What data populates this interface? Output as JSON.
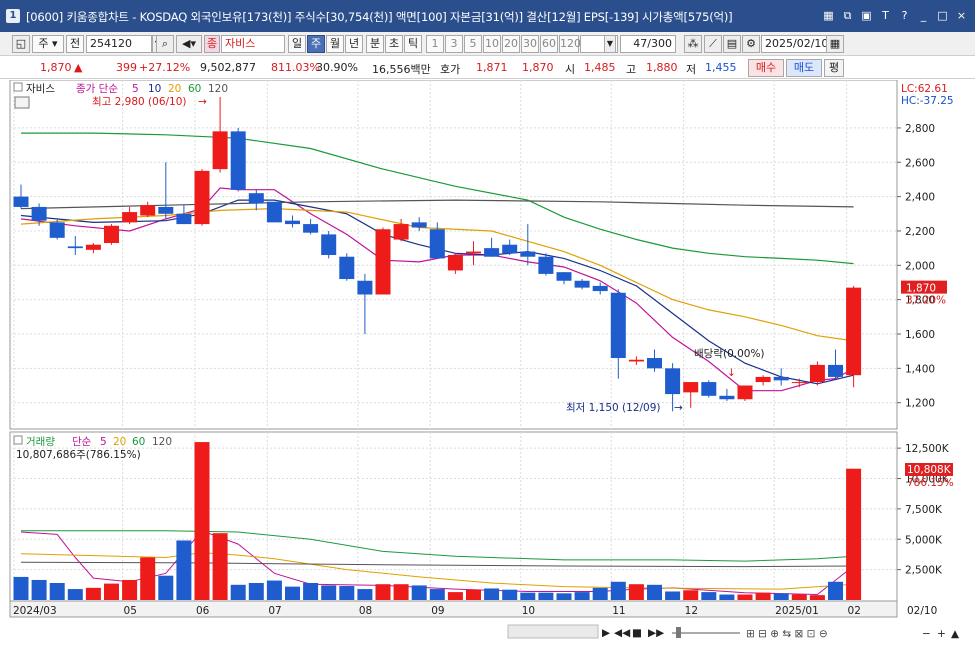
{
  "window": {
    "number": "1",
    "title": "[0600] 키움종합차트 - KOSDAQ 외국인보유[173(천)] 주식수[30,754(천)] 액면[100] 자본금[31(억)] 결산[12월] EPS[-139] 시가총액[575(억)]",
    "icons": [
      "chart-icon",
      "window-copy-icon",
      "save-icon",
      "text-tool-icon",
      "help-icon"
    ],
    "buttons": {
      "minimize": "_",
      "maximize": "□",
      "close": "×"
    }
  },
  "toolbar": {
    "period_type": "주",
    "all_label": "전",
    "code": "254120",
    "search_icon": "magnifier-icon",
    "sound_icon": "speaker-icon",
    "stock_prefix": "종",
    "stock_name": "자비스",
    "periods": [
      "일",
      "주",
      "월",
      "년",
      "분",
      "초",
      "틱"
    ],
    "active_period": "주",
    "intervals": [
      "1",
      "3",
      "5",
      "10",
      "20",
      "30",
      "60",
      "120"
    ],
    "count": "47/300",
    "date": "2025/02/10",
    "calendar_icon": "calendar-icon"
  },
  "quote": {
    "price": "1,870",
    "change_arrow": "▲",
    "change": "399",
    "change_pct": "+27.12%",
    "volume": "9,502,877",
    "volume_ratio": "811.03%",
    "turnover": "30.90%",
    "amount": "16,556백만",
    "hoga_label": "호가",
    "ask": "1,871",
    "bid": "1,870",
    "open_label": "시",
    "open": "1,485",
    "high_label": "고",
    "high": "1,880",
    "low_label": "저",
    "low": "1,455",
    "buy_label": "매수",
    "sell_label": "매도",
    "avg_label": "평"
  },
  "price_legend": {
    "name": "자비스",
    "type": "종가 단순",
    "periods": [
      "5",
      "10",
      "20",
      "60",
      "120"
    ],
    "period_colors": [
      "#c0139b",
      "#1a2f8a",
      "#e0a000",
      "#1a9a3a",
      "#555555"
    ],
    "lc": "LC:62.61",
    "hc": "HC:-37.25",
    "current_price": "1,870",
    "current_pct": "37.20%"
  },
  "annotations": {
    "high_label": "최고 2,980 (06/10)",
    "low_label": "최저 1,150 (12/09)",
    "dividend_label": "배당락(0.00%)"
  },
  "volume_legend": {
    "name": "거래량",
    "type": "단순",
    "periods": [
      "5",
      "20",
      "60",
      "120"
    ],
    "period_colors": [
      "#c0139b",
      "#e0a000",
      "#1a9a3a",
      "#555555"
    ],
    "info": "10,807,686주(786.15%)",
    "current_value": "10,808K",
    "current_pct": "786.15%"
  },
  "x_axis": {
    "labels": [
      "2024/03",
      "05",
      "06",
      "07",
      "08",
      "09",
      "10",
      "11",
      "12",
      "2025/01",
      "02",
      "02/10"
    ]
  },
  "chart_data": {
    "type": "candlestick",
    "candles": [
      {
        "o": 2400,
        "h": 2470,
        "l": 2330,
        "c": 2340
      },
      {
        "o": 2340,
        "h": 2360,
        "l": 2230,
        "c": 2260
      },
      {
        "o": 2250,
        "h": 2270,
        "l": 2150,
        "c": 2160
      },
      {
        "o": 2110,
        "h": 2170,
        "l": 2060,
        "c": 2100
      },
      {
        "o": 2090,
        "h": 2130,
        "l": 2070,
        "c": 2120
      },
      {
        "o": 2130,
        "h": 2240,
        "l": 2120,
        "c": 2230
      },
      {
        "o": 2250,
        "h": 2340,
        "l": 2240,
        "c": 2310
      },
      {
        "o": 2290,
        "h": 2370,
        "l": 2280,
        "c": 2350
      },
      {
        "o": 2340,
        "h": 2600,
        "l": 2270,
        "c": 2300
      },
      {
        "o": 2300,
        "h": 2350,
        "l": 2240,
        "c": 2240
      },
      {
        "o": 2240,
        "h": 2560,
        "l": 2230,
        "c": 2550
      },
      {
        "o": 2560,
        "h": 2980,
        "l": 2540,
        "c": 2780
      },
      {
        "o": 2780,
        "h": 2800,
        "l": 2430,
        "c": 2440
      },
      {
        "o": 2420,
        "h": 2440,
        "l": 2320,
        "c": 2360
      },
      {
        "o": 2370,
        "h": 2370,
        "l": 2250,
        "c": 2250
      },
      {
        "o": 2260,
        "h": 2290,
        "l": 2220,
        "c": 2240
      },
      {
        "o": 2240,
        "h": 2270,
        "l": 2180,
        "c": 2190
      },
      {
        "o": 2180,
        "h": 2200,
        "l": 2040,
        "c": 2060
      },
      {
        "o": 2050,
        "h": 2070,
        "l": 1910,
        "c": 1920
      },
      {
        "o": 1910,
        "h": 1950,
        "l": 1600,
        "c": 1830
      },
      {
        "o": 1830,
        "h": 2220,
        "l": 1830,
        "c": 2210
      },
      {
        "o": 2150,
        "h": 2270,
        "l": 2140,
        "c": 2240
      },
      {
        "o": 2250,
        "h": 2280,
        "l": 2200,
        "c": 2220
      },
      {
        "o": 2210,
        "h": 2250,
        "l": 2040,
        "c": 2040
      },
      {
        "o": 1970,
        "h": 2070,
        "l": 1950,
        "c": 2060
      },
      {
        "o": 2070,
        "h": 2140,
        "l": 2000,
        "c": 2080
      },
      {
        "o": 2100,
        "h": 2160,
        "l": 2050,
        "c": 2050
      },
      {
        "o": 2120,
        "h": 2150,
        "l": 2060,
        "c": 2070
      },
      {
        "o": 2080,
        "h": 2240,
        "l": 2000,
        "c": 2050
      },
      {
        "o": 2050,
        "h": 2070,
        "l": 1940,
        "c": 1950
      },
      {
        "o": 1960,
        "h": 1960,
        "l": 1890,
        "c": 1910
      },
      {
        "o": 1910,
        "h": 1920,
        "l": 1860,
        "c": 1870
      },
      {
        "o": 1880,
        "h": 1900,
        "l": 1830,
        "c": 1850
      },
      {
        "o": 1840,
        "h": 1860,
        "l": 1340,
        "c": 1460
      },
      {
        "o": 1440,
        "h": 1470,
        "l": 1420,
        "c": 1450
      },
      {
        "o": 1460,
        "h": 1510,
        "l": 1380,
        "c": 1400
      },
      {
        "o": 1400,
        "h": 1430,
        "l": 1150,
        "c": 1250
      },
      {
        "o": 1260,
        "h": 1320,
        "l": 1170,
        "c": 1320
      },
      {
        "o": 1320,
        "h": 1330,
        "l": 1230,
        "c": 1240
      },
      {
        "o": 1240,
        "h": 1280,
        "l": 1210,
        "c": 1220
      },
      {
        "o": 1220,
        "h": 1300,
        "l": 1210,
        "c": 1300
      },
      {
        "o": 1320,
        "h": 1360,
        "l": 1300,
        "c": 1350
      },
      {
        "o": 1350,
        "h": 1400,
        "l": 1300,
        "c": 1330
      },
      {
        "o": 1320,
        "h": 1340,
        "l": 1290,
        "c": 1320
      },
      {
        "o": 1320,
        "h": 1440,
        "l": 1300,
        "c": 1420
      },
      {
        "o": 1420,
        "h": 1510,
        "l": 1340,
        "c": 1350
      },
      {
        "o": 1360,
        "h": 1880,
        "l": 1290,
        "c": 1870
      }
    ],
    "volumes": [
      1900,
      1650,
      1400,
      900,
      1000,
      1350,
      1650,
      3500,
      2000,
      4900,
      13000,
      5500,
      1250,
      1400,
      1600,
      1100,
      1400,
      1200,
      1150,
      900,
      1300,
      1300,
      1200,
      900,
      650,
      850,
      950,
      850,
      600,
      600,
      550,
      650,
      1000,
      1500,
      1300,
      1250,
      700,
      800,
      650,
      450,
      450,
      600,
      550,
      450,
      400,
      1500,
      10808
    ],
    "ma_price": [
      {
        "period": "5",
        "color": "#c0139b",
        "points": [
          [
            0,
            2270
          ],
          [
            3,
            2230
          ],
          [
            6,
            2200
          ],
          [
            8,
            2270
          ],
          [
            10,
            2330
          ],
          [
            11,
            2450
          ],
          [
            12,
            2440
          ],
          [
            14,
            2440
          ],
          [
            16,
            2300
          ],
          [
            18,
            2180
          ],
          [
            20,
            2030
          ],
          [
            22,
            2020
          ],
          [
            24,
            2060
          ],
          [
            26,
            2060
          ],
          [
            28,
            2020
          ],
          [
            30,
            1990
          ],
          [
            32,
            1910
          ],
          [
            34,
            1780
          ],
          [
            36,
            1580
          ],
          [
            38,
            1440
          ],
          [
            40,
            1270
          ],
          [
            42,
            1270
          ],
          [
            44,
            1330
          ],
          [
            45,
            1340
          ],
          [
            46,
            1400
          ]
        ]
      },
      {
        "period": "10",
        "color": "#1a2f8a",
        "points": [
          [
            0,
            2290
          ],
          [
            4,
            2250
          ],
          [
            8,
            2260
          ],
          [
            10,
            2300
          ],
          [
            12,
            2380
          ],
          [
            14,
            2380
          ],
          [
            16,
            2340
          ],
          [
            18,
            2300
          ],
          [
            20,
            2180
          ],
          [
            22,
            2120
          ],
          [
            24,
            2070
          ],
          [
            26,
            2060
          ],
          [
            28,
            2080
          ],
          [
            30,
            2040
          ],
          [
            32,
            1970
          ],
          [
            34,
            1880
          ],
          [
            36,
            1720
          ],
          [
            38,
            1560
          ],
          [
            40,
            1430
          ],
          [
            42,
            1350
          ],
          [
            44,
            1310
          ],
          [
            46,
            1360
          ]
        ]
      },
      {
        "period": "20",
        "color": "#e0a000",
        "points": [
          [
            0,
            2240
          ],
          [
            4,
            2270
          ],
          [
            8,
            2290
          ],
          [
            11,
            2320
          ],
          [
            14,
            2330
          ],
          [
            18,
            2310
          ],
          [
            22,
            2220
          ],
          [
            26,
            2200
          ],
          [
            28,
            2140
          ],
          [
            30,
            2080
          ],
          [
            32,
            2000
          ],
          [
            34,
            1900
          ],
          [
            36,
            1800
          ],
          [
            38,
            1740
          ],
          [
            40,
            1700
          ],
          [
            42,
            1650
          ],
          [
            44,
            1590
          ],
          [
            46,
            1560
          ]
        ]
      },
      {
        "period": "60",
        "color": "#1a9a3a",
        "points": [
          [
            0,
            2770
          ],
          [
            4,
            2770
          ],
          [
            8,
            2760
          ],
          [
            12,
            2740
          ],
          [
            16,
            2680
          ],
          [
            20,
            2560
          ],
          [
            24,
            2460
          ],
          [
            28,
            2380
          ],
          [
            30,
            2280
          ],
          [
            32,
            2210
          ],
          [
            34,
            2150
          ],
          [
            36,
            2100
          ],
          [
            38,
            2070
          ],
          [
            40,
            2050
          ],
          [
            42,
            2040
          ],
          [
            44,
            2030
          ],
          [
            46,
            2010
          ]
        ]
      },
      {
        "period": "120",
        "color": "#555555",
        "points": [
          [
            0,
            2330
          ],
          [
            8,
            2350
          ],
          [
            16,
            2370
          ],
          [
            24,
            2380
          ],
          [
            32,
            2370
          ],
          [
            36,
            2360
          ],
          [
            40,
            2350
          ],
          [
            46,
            2340
          ]
        ]
      }
    ],
    "ma_volume": [
      {
        "period": "5",
        "color": "#c0139b",
        "points": [
          [
            0,
            5600
          ],
          [
            2,
            5400
          ],
          [
            3,
            3500
          ],
          [
            4,
            1800
          ],
          [
            6,
            1500
          ],
          [
            8,
            2200
          ],
          [
            10,
            5700
          ],
          [
            12,
            4600
          ],
          [
            14,
            2200
          ],
          [
            16,
            1300
          ],
          [
            20,
            1200
          ],
          [
            24,
            900
          ],
          [
            28,
            700
          ],
          [
            32,
            700
          ],
          [
            34,
            900
          ],
          [
            36,
            1000
          ],
          [
            40,
            600
          ],
          [
            44,
            450
          ],
          [
            46,
            2800
          ]
        ]
      },
      {
        "period": "20",
        "color": "#e0a000",
        "points": [
          [
            0,
            3800
          ],
          [
            8,
            3500
          ],
          [
            10,
            3900
          ],
          [
            12,
            3700
          ],
          [
            14,
            3400
          ],
          [
            18,
            2500
          ],
          [
            22,
            1900
          ],
          [
            26,
            1400
          ],
          [
            30,
            1100
          ],
          [
            34,
            1000
          ],
          [
            38,
            950
          ],
          [
            42,
            900
          ],
          [
            46,
            1300
          ]
        ]
      },
      {
        "period": "60",
        "color": "#1a9a3a",
        "points": [
          [
            0,
            5700
          ],
          [
            8,
            5700
          ],
          [
            12,
            5600
          ],
          [
            16,
            5000
          ],
          [
            20,
            4000
          ],
          [
            24,
            3600
          ],
          [
            30,
            3300
          ],
          [
            36,
            3300
          ],
          [
            40,
            3200
          ],
          [
            44,
            3400
          ],
          [
            46,
            3600
          ]
        ]
      },
      {
        "period": "120",
        "color": "#555555",
        "points": [
          [
            0,
            3100
          ],
          [
            10,
            3050
          ],
          [
            20,
            2900
          ],
          [
            30,
            2800
          ],
          [
            40,
            2750
          ],
          [
            46,
            2800
          ]
        ]
      }
    ],
    "y_price_ticks": [
      1200,
      1400,
      1600,
      1800,
      2000,
      2200,
      2400,
      2600,
      2800
    ],
    "y_price_tick_labels": [
      "1,200",
      "1,400",
      "1,600",
      "1,800",
      "2,000",
      "2,200",
      "2,400",
      "2,600",
      "2,800"
    ],
    "y_volume_ticks": [
      2500,
      5000,
      7500,
      10000,
      12500
    ],
    "y_volume_tick_labels": [
      "2,500K",
      "5,000K",
      "7,500K",
      "10,000K",
      "12,500K"
    ],
    "ylim_price": [
      1070,
      3050
    ],
    "ylim_volume": [
      0,
      13500
    ],
    "x_label_index": [
      0,
      6,
      10,
      14,
      19,
      23,
      28,
      33,
      37,
      42,
      46
    ],
    "up_color": "#ee1b1b",
    "down_color": "#1f5ccd"
  }
}
